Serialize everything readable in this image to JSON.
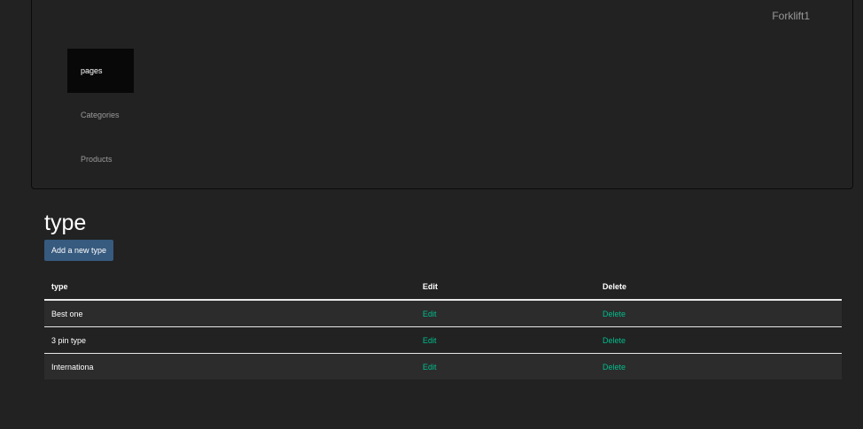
{
  "navbar": {
    "brand": "Forklift1",
    "items": [
      {
        "label": "pages",
        "active": true
      },
      {
        "label": "Categories",
        "active": false
      },
      {
        "label": "Products",
        "active": false
      }
    ]
  },
  "main": {
    "title": "type",
    "add_button_label": "Add a new type",
    "table": {
      "headers": [
        "type",
        "Edit",
        "Delete"
      ],
      "rows": [
        {
          "type": "Best one",
          "edit": "Edit",
          "delete": "Delete"
        },
        {
          "type": "3 pin type",
          "edit": "Edit",
          "delete": "Delete"
        },
        {
          "type": "Internationa",
          "edit": "Edit",
          "delete": "Delete"
        }
      ]
    }
  },
  "colors": {
    "background": "#222222",
    "active_nav": "#080808",
    "primary_button": "#375a7f",
    "link": "#00bc8c"
  }
}
